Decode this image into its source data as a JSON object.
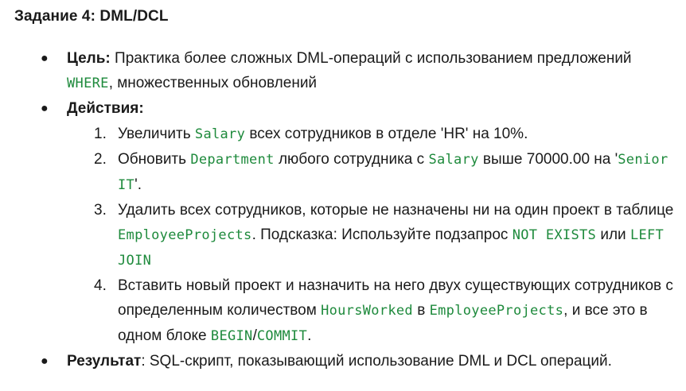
{
  "title": "Задание 4: DML/DCL",
  "goal": {
    "label": "Цель:",
    "text_1": " Практика более сложных DML-операций с использованием предложений ",
    "code_1": "WHERE",
    "text_2": ", множественных обновлений"
  },
  "actions": {
    "label": "Действия:",
    "steps": [
      {
        "num": "1.",
        "t1": "Увеличить ",
        "c1": "Salary",
        "t2": " всех сотрудников в отделе 'HR' на 10%."
      },
      {
        "num": "2.",
        "t1": "Обновить ",
        "c1": "Department",
        "t2": " любого сотрудника с ",
        "c2": "Salary",
        "t3": " выше 70000.00 на '",
        "c3": "Senior IT",
        "t4": "'."
      },
      {
        "num": "3.",
        "t1": "Удалить всех сотрудников, которые не назначены ни на один проект в таблице ",
        "c1": "EmployeeProjects",
        "t2": ". Подсказка: Используйте подзапрос ",
        "c2": "NOT EXISTS",
        "t3": " или ",
        "c3": "LEFT JOIN"
      },
      {
        "num": "4.",
        "t1": "Вставить новый проект и назначить на него двух существующих сотрудников с определенным количеством ",
        "c1": "HoursWorked",
        "t2": " в ",
        "c2": "EmployeeProjects",
        "t3": ", и все это в одном блоке ",
        "c3": "BEGIN",
        "t4": "/",
        "c4": "COMMIT",
        "t5": "."
      }
    ]
  },
  "result": {
    "label": "Результат",
    "text": ": SQL-скрипт, показывающий использование DML и DCL операций."
  },
  "bullet_char": "●",
  "colors": {
    "code": "#1e8a3c",
    "text": "#1a1a1a"
  }
}
